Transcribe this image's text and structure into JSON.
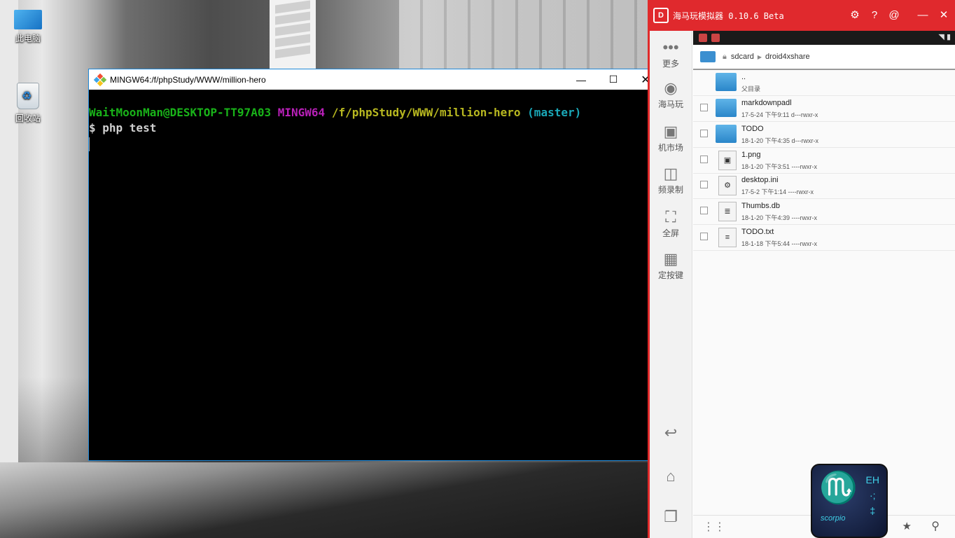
{
  "desktop": {
    "icons": [
      {
        "label": "此电脑",
        "icon": "computer-icon"
      },
      {
        "label": "回收站",
        "icon": "recycle-bin-icon"
      }
    ]
  },
  "terminal": {
    "title": "MINGW64:/f/phpStudy/WWW/million-hero",
    "buttons": {
      "minimize": "—",
      "maximize": "☐",
      "close": "✕"
    },
    "prompt": {
      "user_host": "WaitMoonMan@DESKTOP-TT97A03",
      "env": "MINGW64",
      "path": "/f/phpStudy/WWW/million-hero",
      "branch": "(master)"
    },
    "command_line": "$ php test",
    "colors": {
      "user": "#19b319",
      "env": "#b820b8",
      "path": "#b8b820",
      "branch": "#1aa8b8"
    }
  },
  "emulator": {
    "title": "海马玩模拟器 0.10.6 Beta",
    "accent_color": "#e0292d",
    "title_buttons": [
      "gear-icon",
      "help-icon",
      "at-icon",
      "minimize-icon",
      "close-icon"
    ],
    "sidebar": [
      {
        "label": "更多",
        "icon": "more-icon"
      },
      {
        "label": "海马玩",
        "icon": "haima-icon"
      },
      {
        "label": "机市场",
        "icon": "market-icon"
      },
      {
        "label": "频录制",
        "icon": "video-record-icon"
      },
      {
        "label": "全屏",
        "icon": "fullscreen-icon"
      },
      {
        "label": "定按键",
        "icon": "keymap-icon"
      },
      {
        "label": "",
        "icon": "back-icon"
      },
      {
        "label": "",
        "icon": "home-icon"
      },
      {
        "label": "",
        "icon": "recent-apps-icon"
      }
    ],
    "file_manager": {
      "breadcrumb": [
        "sdcard",
        "droid4xshare"
      ],
      "rows": [
        {
          "name": "..",
          "meta": "父目录",
          "type": "folder",
          "checkbox": false
        },
        {
          "name": "markdownpadl",
          "meta": "17-5-24 下午9:11   d---rwxr-x",
          "type": "folder",
          "checkbox": true
        },
        {
          "name": "TODO",
          "meta": "18-1-20 下午4:35   d---rwxr-x",
          "type": "folder",
          "checkbox": true
        },
        {
          "name": "1.png",
          "meta": "18-1-20 下午3:51   ----rwxr-x",
          "type": "image",
          "checkbox": true
        },
        {
          "name": "desktop.ini",
          "meta": "17-5-2 下午1:14   ----rwxr-x",
          "type": "settings",
          "checkbox": true
        },
        {
          "name": "Thumbs.db",
          "meta": "18-1-20 下午4:39   ----rwxr-x",
          "type": "database",
          "checkbox": true
        },
        {
          "name": "TODO.txt",
          "meta": "18-1-18 下午5:44   ----rwxr-x",
          "type": "text",
          "checkbox": true
        }
      ]
    }
  },
  "badge": {
    "glyph": "♏",
    "text": "scorpio",
    "side_text": [
      "EH",
      "·;",
      "‡"
    ]
  }
}
